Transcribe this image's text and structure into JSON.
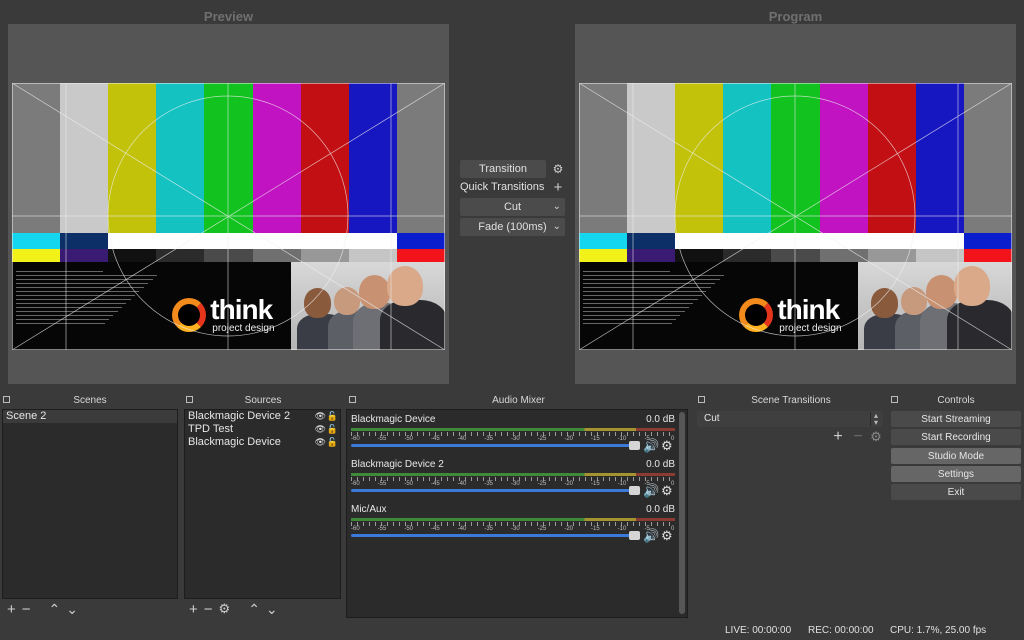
{
  "preview": {
    "title": "Preview"
  },
  "program": {
    "title": "Program"
  },
  "test_card": {
    "bar_colors": [
      "#7b7b7b",
      "#c9c9c9",
      "#c2c20b",
      "#14c2c2",
      "#12c21f",
      "#c113c1",
      "#c20f14",
      "#1717c2",
      "#7b7b7b"
    ],
    "strip_colors": [
      "#14d7ef",
      "#0b2f66",
      "#ffffff",
      "#ffffff",
      "#ffffff",
      "#ffffff",
      "#ffffff",
      "#ffffff",
      "#0a1ecd"
    ],
    "strip2_colors": [
      "#f2f21a",
      "#3a1b73",
      "#111111",
      "#2b2b2b",
      "#4a4a4a",
      "#707070",
      "#989898",
      "#c5c5c5",
      "#f2141a"
    ],
    "logo_main": "think",
    "logo_sub": "project design"
  },
  "transitions_mid": {
    "transition_label": "Transition",
    "quick_label": "Quick Transitions",
    "cut_label": "Cut",
    "fade_label": "Fade (100ms)"
  },
  "scenes": {
    "title": "Scenes",
    "items": [
      "Scene 2"
    ]
  },
  "sources": {
    "title": "Sources",
    "items": [
      "Blackmagic Device 2",
      "TPD Test",
      "Blackmagic Device"
    ]
  },
  "mixer": {
    "title": "Audio Mixer",
    "channels": [
      {
        "name": "Blackmagic Device",
        "db": "0.0 dB"
      },
      {
        "name": "Blackmagic Device 2",
        "db": "0.0 dB"
      },
      {
        "name": "Mic/Aux",
        "db": "0.0 dB"
      }
    ],
    "tick_labels": [
      "-60",
      "-55",
      "-50",
      "-45",
      "-40",
      "-35",
      "-30",
      "-25",
      "-20",
      "-15",
      "-10",
      "-5",
      "0"
    ]
  },
  "scene_transitions": {
    "title": "Scene Transitions",
    "selected": "Cut"
  },
  "controls": {
    "title": "Controls",
    "start_streaming": "Start Streaming",
    "start_recording": "Start Recording",
    "studio_mode": "Studio Mode",
    "settings": "Settings",
    "exit": "Exit"
  },
  "status": {
    "live": "LIVE: 00:00:00",
    "rec": "REC: 00:00:00",
    "cpu": "CPU: 1.7%, 25.00 fps"
  },
  "icons": {
    "plus": "+",
    "minus": "−",
    "up": "⌃",
    "down": "⌄",
    "gear": "⚙",
    "eye": "👁",
    "lock": "🔓",
    "speaker": "🔊",
    "chevron": "⌄"
  }
}
